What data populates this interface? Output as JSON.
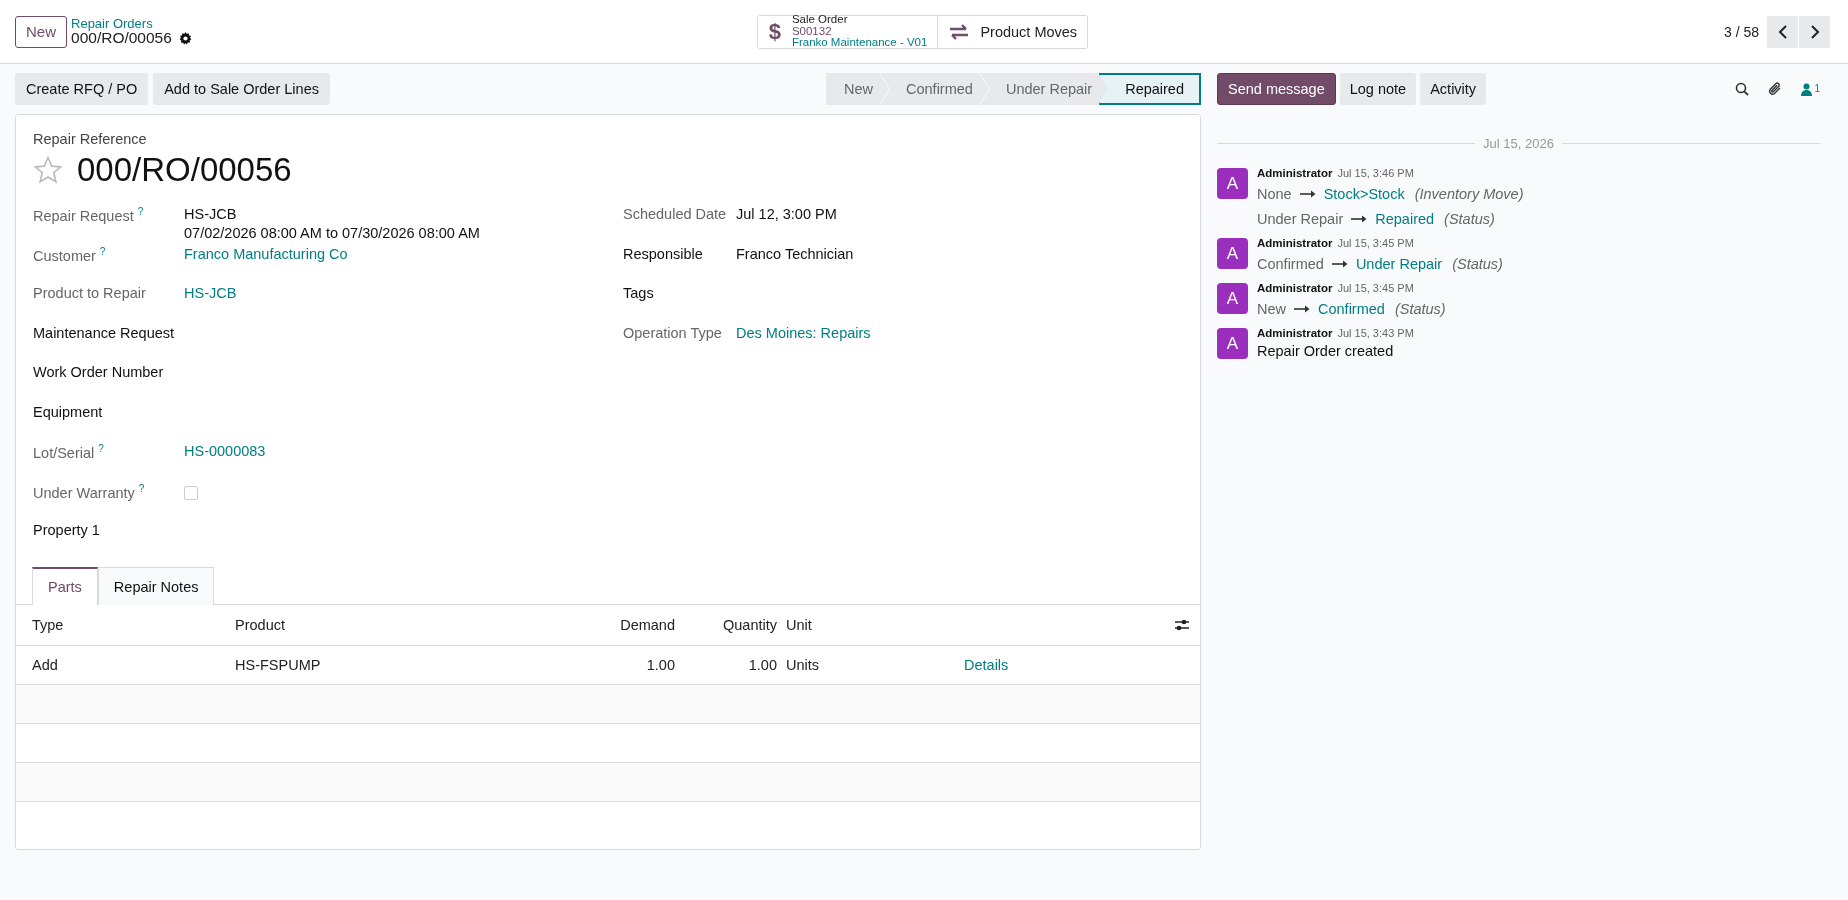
{
  "header": {
    "new_button": "New",
    "breadcrumb": "Repair Orders",
    "record": "000/RO/00056",
    "smart_buttons": [
      {
        "kind": "sale",
        "icon": "$",
        "title": "Sale Order",
        "lines": [
          "S00132",
          "Franko Maintenance - V01"
        ]
      },
      {
        "kind": "moves",
        "title": "Product Moves"
      }
    ],
    "pager": "3 / 58"
  },
  "actions": [
    "Create RFQ / PO",
    "Add to Sale Order Lines"
  ],
  "statusbar": [
    {
      "label": "New",
      "selected": false
    },
    {
      "label": "Confirmed",
      "selected": false
    },
    {
      "label": "Under Repair",
      "selected": false
    },
    {
      "label": "Repaired",
      "selected": true
    }
  ],
  "form": {
    "reference_label": "Repair Reference",
    "starred": false,
    "title": "000/RO/00056",
    "left_fields": [
      {
        "label": "Repair Request",
        "help": "?",
        "strong": false,
        "kind": "text",
        "values": [
          "HS-JCB",
          "07/02/2026 08:00 AM to 07/30/2026 08:00 AM"
        ]
      },
      {
        "label": "Customer",
        "help": "?",
        "strong": false,
        "kind": "link",
        "values": [
          "Franco Manufacturing Co"
        ]
      },
      {
        "label": "Product to Repair",
        "strong": false,
        "kind": "link",
        "values": [
          "HS-JCB"
        ]
      },
      {
        "label": "Maintenance Request",
        "strong": true,
        "kind": "empty"
      },
      {
        "label": "Work Order Number",
        "strong": true,
        "kind": "empty"
      },
      {
        "label": "Equipment",
        "strong": true,
        "kind": "empty"
      },
      {
        "label": "Lot/Serial",
        "help": "?",
        "strong": false,
        "kind": "link",
        "values": [
          "HS-0000083"
        ]
      },
      {
        "label": "Under Warranty",
        "help": "?",
        "strong": false,
        "kind": "checkbox",
        "checked": false
      },
      {
        "label": "Property 1",
        "strong": true,
        "kind": "empty"
      }
    ],
    "right_fields": [
      {
        "label": "Scheduled Date",
        "strong": false,
        "kind": "text",
        "values": [
          "Jul 12, 3:00 PM"
        ]
      },
      {
        "label": "Responsible",
        "strong": true,
        "kind": "text",
        "values": [
          "Franco Technician"
        ]
      },
      {
        "label": "Tags",
        "strong": true,
        "kind": "empty"
      },
      {
        "label": "Operation Type",
        "strong": false,
        "kind": "link",
        "values": [
          "Des Moines: Repairs"
        ]
      }
    ]
  },
  "tabs": [
    {
      "label": "Parts",
      "selected": true
    },
    {
      "label": "Repair Notes",
      "selected": false
    }
  ],
  "table": {
    "columns": [
      {
        "label": "Type",
        "kind": "text"
      },
      {
        "label": "Product",
        "kind": "text"
      },
      {
        "label": "Demand",
        "kind": "number"
      },
      {
        "label": "Quantity",
        "kind": "number"
      },
      {
        "label": "Unit",
        "kind": "text"
      }
    ],
    "rows": [
      {
        "cells": [
          "Add",
          "HS-FSPUMP",
          "1.00",
          "1.00",
          "Units"
        ],
        "link": "Details"
      }
    ]
  },
  "chatter": {
    "buttons": [
      {
        "label": "Send message",
        "selected": true
      },
      {
        "label": "Log note",
        "selected": false
      },
      {
        "label": "Activity",
        "selected": false
      }
    ],
    "followers": "1",
    "date": "Jul 15, 2026",
    "messages": [
      {
        "avatar": "A",
        "author": "Administrator",
        "time": "Jul 15, 3:46 PM",
        "changes": [
          {
            "from": "None",
            "to": "Stock>Stock",
            "field": "(Inventory Move)"
          },
          {
            "from": "Under Repair",
            "to": "Repaired",
            "field": "(Status)"
          }
        ]
      },
      {
        "avatar": "A",
        "author": "Administrator",
        "time": "Jul 15, 3:45 PM",
        "changes": [
          {
            "from": "Confirmed",
            "to": "Under Repair",
            "field": "(Status)"
          }
        ]
      },
      {
        "avatar": "A",
        "author": "Administrator",
        "time": "Jul 15, 3:45 PM",
        "changes": [
          {
            "from": "New",
            "to": "Confirmed",
            "field": "(Status)"
          }
        ]
      },
      {
        "avatar": "A",
        "author": "Administrator",
        "time": "Jul 15, 3:43 PM",
        "body": "Repair Order created"
      }
    ]
  }
}
